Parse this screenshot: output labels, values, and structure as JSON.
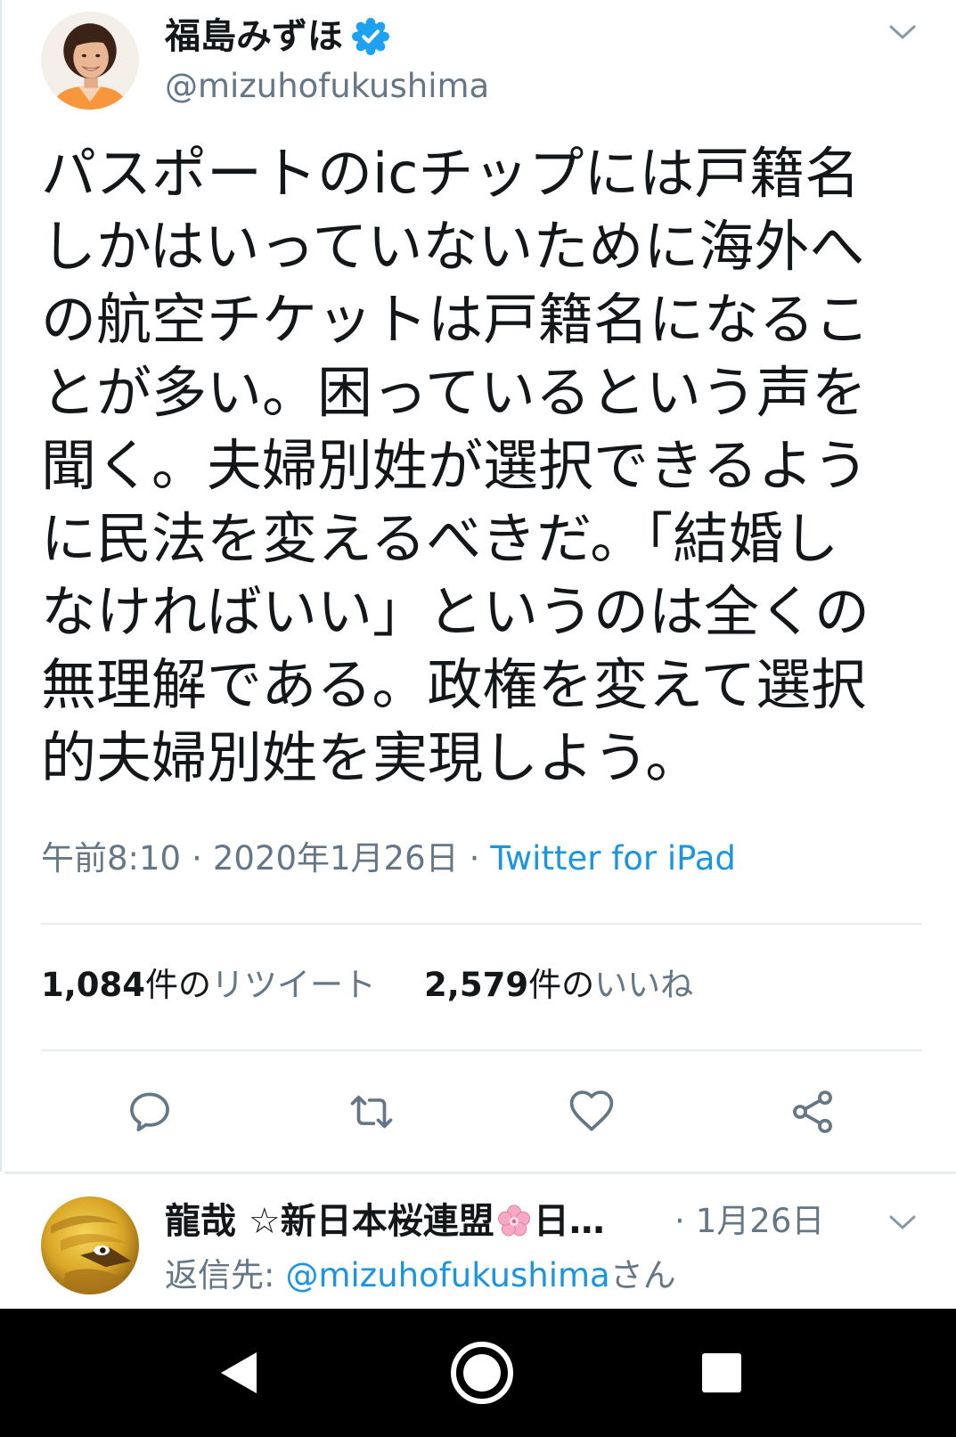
{
  "tweet": {
    "author": {
      "name": "福島みずほ",
      "handle": "@mizuhofukushima",
      "verified": true
    },
    "body_lines": [
      "パスポートのicチップには戸籍名",
      "しかはいっていないために海外へ",
      "の航空チケットは戸籍名になるこ",
      "とが多い。困っているという声を",
      "聞く。夫婦別姓が選択できるよう",
      "に民法を変えるべきだ。「結婚し",
      "なければいい」というのは全くの",
      "無理解である。政権を変えて選択",
      "的夫婦別姓を実現しよう。"
    ],
    "meta": {
      "time": "午前8:10",
      "separator": "·",
      "date": "2020年1月26日",
      "source": "Twitter for iPad"
    },
    "stats": {
      "retweets": {
        "count": "1,084",
        "unit": "件の",
        "label": "リツイート"
      },
      "likes": {
        "count": "2,579",
        "unit": "件の",
        "label": "いいね"
      }
    },
    "actions": [
      "reply-icon",
      "retweet-icon",
      "like-icon",
      "share-icon"
    ]
  },
  "reply": {
    "author": {
      "name": "龍哉 ☆新日本桜連盟",
      "emoji_icon": "cherry-blossom-icon",
      "name_truncated": "日…"
    },
    "separator": "·",
    "date": "1月26日",
    "reply_to": {
      "label": "返信先:",
      "handle": "@mizuhofukushima",
      "suffix": "さん"
    }
  },
  "nav_bar": {
    "icons": [
      "back-icon",
      "home-icon",
      "recents-icon"
    ]
  },
  "colors": {
    "text": "#14171a",
    "secondary_text": "#657786",
    "link": "#1b95e0",
    "verified_badge": "#1da1f2",
    "divider": "#e6ecf0",
    "nav_bar": "#000000"
  }
}
